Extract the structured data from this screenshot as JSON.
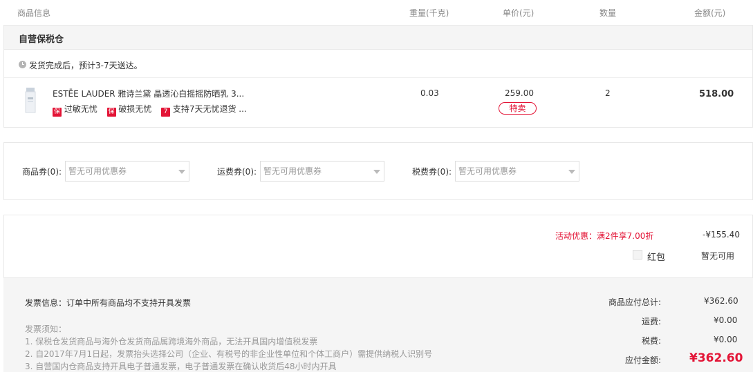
{
  "header": {
    "col_product": "商品信息",
    "col_weight": "重量(千克)",
    "col_price": "单价(元)",
    "col_qty": "数量",
    "col_amount": "金额(元)"
  },
  "warehouse": {
    "title": "自营保税仓",
    "delivery_note": "发货完成后，预计3-7天送达。"
  },
  "product": {
    "name": "ESTĒE LAUDER 雅诗兰黛 晶透沁白摇摇防晒乳 3...",
    "tags": [
      {
        "icon": "保",
        "label": "过敏无忧"
      },
      {
        "icon": "保",
        "label": "破损无忧"
      },
      {
        "icon": "7",
        "label": "支持7天无忧退货 ..."
      }
    ],
    "weight": "0.03",
    "unit_price": "259.00",
    "badge": "特卖",
    "quantity": "2",
    "amount": "518.00"
  },
  "coupons": {
    "product": {
      "label": "商品券(0):",
      "placeholder": "暂无可用优惠券"
    },
    "shipping": {
      "label": "运费券(0):",
      "placeholder": "暂无可用优惠券"
    },
    "tax": {
      "label": "税费券(0):",
      "placeholder": "暂无可用优惠券"
    }
  },
  "promotion": {
    "label": "活动优惠：满2件享7.00折",
    "value": "-¥155.40",
    "redpacket_label": "红包",
    "redpacket_value": "暂无可用"
  },
  "invoice": {
    "info": "发票信息：订单中所有商品均不支持开具发票",
    "notice_title": "发票须知：",
    "notes": [
      "1. 保税仓发货商品与海外仓发货商品属跨境海外商品，无法开具国内增值税发票",
      "2. 自2017年7月1日起，发票抬头选择公司（企业、有税号的非企业性单位和个体工商户）需提供纳税人识别号",
      "3. 自营国内仓商品支持开具电子普通发票，电子普通发票在确认收货后48小时内开具"
    ]
  },
  "summary": {
    "subtotal_label": "商品应付总计:",
    "subtotal_value": "¥362.60",
    "shipping_label": "运费:",
    "shipping_value": "¥0.00",
    "tax_label": "税费:",
    "tax_value": "¥0.00",
    "total_label": "应付金额:",
    "total_value": "¥362.60"
  },
  "colors": {
    "accent_red": "#e31436",
    "muted_gray": "#999999",
    "panel_bg": "#f5f5f5"
  }
}
